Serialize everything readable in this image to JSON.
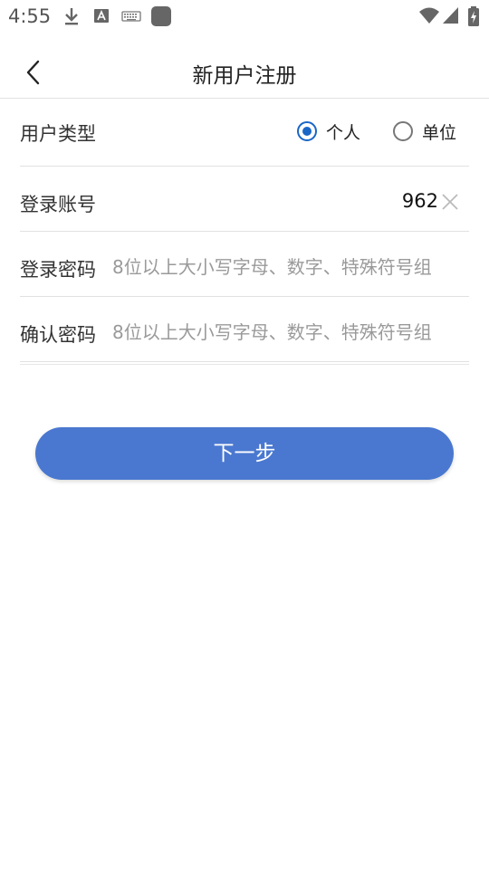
{
  "status_bar": {
    "time": "4:55",
    "icons": [
      "download-icon",
      "a-badge-icon",
      "keyboard-icon",
      "square-app-icon",
      "wifi-icon",
      "signal-icon",
      "battery-charging-icon"
    ]
  },
  "header": {
    "title": "新用户注册",
    "back_icon": "chevron-left-icon"
  },
  "form": {
    "user_type": {
      "label": "用户类型",
      "options": [
        {
          "label": "个人",
          "checked": true
        },
        {
          "label": "单位",
          "checked": false
        }
      ]
    },
    "account": {
      "label": "登录账号",
      "value": "962",
      "clear_icon": "close-icon"
    },
    "password": {
      "label": "登录密码",
      "placeholder": "8位以上大小写字母、数字、特殊符号组"
    },
    "confirm_password": {
      "label": "确认密码",
      "placeholder": "8位以上大小写字母、数字、特殊符号组"
    }
  },
  "next_button": {
    "label": "下一步"
  },
  "colors": {
    "accent": "#1a66c7",
    "button": "#4a78d0",
    "placeholder": "#9a9a9a"
  }
}
